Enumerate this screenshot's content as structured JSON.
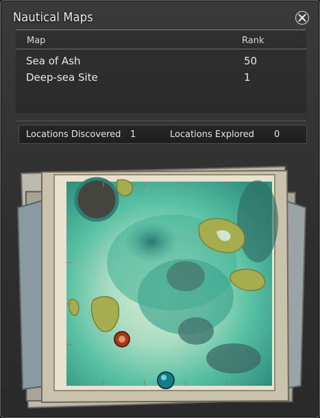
{
  "window": {
    "title": "Nautical Maps"
  },
  "table": {
    "headers": {
      "map": "Map",
      "rank": "Rank"
    },
    "rows": [
      {
        "name": "Sea of Ash",
        "rank": "50"
      },
      {
        "name": "Deep-sea Site",
        "rank": "1"
      }
    ]
  },
  "stats": {
    "discovered_label": "Locations Discovered",
    "discovered_value": "1",
    "explored_label": "Locations Explored",
    "explored_value": "0"
  },
  "map": {
    "pins": [
      {
        "name": "red-location-pin",
        "color": "#a33a1a"
      },
      {
        "name": "teal-location-pin",
        "color": "#127d8a"
      }
    ]
  },
  "icons": {
    "close": "close-icon"
  },
  "colors": {
    "accent": "#d7d7d7",
    "sea": "#3fb59a"
  }
}
